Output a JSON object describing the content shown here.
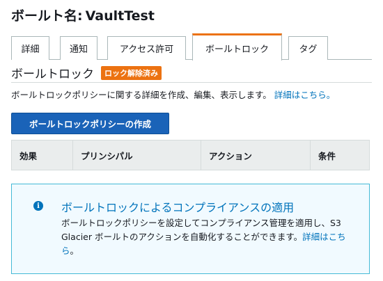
{
  "header": {
    "label": "ボールト名:",
    "vault_name": "VaultTest"
  },
  "tabs": [
    {
      "label": "詳細",
      "active": false
    },
    {
      "label": "通知",
      "active": false
    },
    {
      "label": "アクセス許可",
      "active": false
    },
    {
      "label": "ボールトロック",
      "active": true
    },
    {
      "label": "タグ",
      "active": false
    }
  ],
  "section": {
    "title": "ボールトロック",
    "badge": "ロック解除済み",
    "badge_color": "#ec7211",
    "description": "ボールトロックポリシーに関する詳細を作成、編集、表示します。",
    "description_link": "詳細はこちら。"
  },
  "create_button": {
    "label": "ボールトロックポリシーの作成"
  },
  "table": {
    "columns": [
      "効果",
      "プリンシパル",
      "アクション",
      "条件"
    ]
  },
  "info": {
    "icon": "info-icon",
    "heading": "ボールトロックによるコンプライアンスの適用",
    "body": "ボールトロックポリシーを設定してコンプライアンス管理を適用し、S3 Glacier ボールトのアクションを自動化することができます。",
    "link": "詳細はこちら",
    "link_suffix": "。"
  },
  "colors": {
    "accent": "#ec7211",
    "primary_button": "#1a63b8",
    "link": "#0073bb",
    "info_border": "#44b9d6",
    "info_background": "#f1faff"
  }
}
